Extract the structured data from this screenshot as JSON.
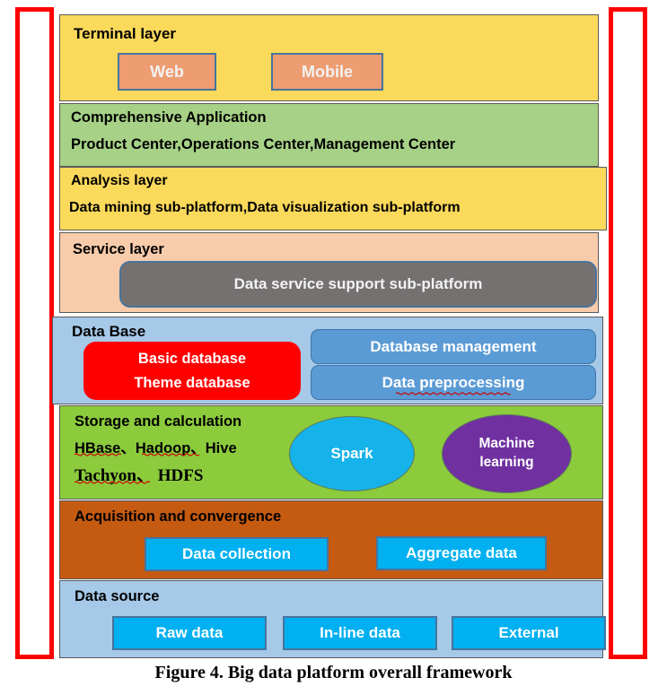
{
  "figure": {
    "caption": "Figure 4. Big data platform overall framework"
  },
  "annotations": {
    "left_bracket_label": "red-highlight-rectangle",
    "right_bracket_label": "red-highlight-rectangle",
    "accent_color": "#FF0000"
  },
  "layers": {
    "terminal": {
      "title": "Terminal layer",
      "color": "#FBD95B",
      "nodes": [
        {
          "label": "Web",
          "color": "#EE9C71"
        },
        {
          "label": "Mobile",
          "color": "#EE9C71"
        }
      ]
    },
    "comprehensive": {
      "title": "Comprehensive Application",
      "subtitle": "Product Center,Operations Center,Management Center",
      "color": "#A6D186"
    },
    "analysis": {
      "title": "Analysis layer",
      "subtitle": "Data mining sub-platform,Data visualization sub-platform",
      "color": "#FBD95B"
    },
    "service": {
      "title": "Service layer",
      "color": "#F8CBAA",
      "nodes": [
        {
          "label": "Data service support sub-platform",
          "color": "#767171"
        }
      ]
    },
    "database": {
      "title": "Data Base",
      "color": "#A6C9E8",
      "nodes": [
        {
          "label_line1": "Basic database",
          "label_line2": "Theme database",
          "color": "#FF0000"
        },
        {
          "label": "Database management",
          "color": "#5B9BD5"
        },
        {
          "label": "Data preprocessing",
          "color": "#5B9BD5"
        }
      ]
    },
    "storage": {
      "title": "Storage and calculation",
      "color": "#8CCB3C",
      "tech_line1": "HBase、Hadoop、Hive",
      "tech_line2": "Tachyon、 HDFS",
      "nodes": [
        {
          "label": "Spark",
          "color": "#16B2EA"
        },
        {
          "label_line1": "Machine",
          "label_line2": "learning",
          "color": "#7030A0"
        }
      ]
    },
    "acquisition": {
      "title": "Acquisition and convergence",
      "color": "#C55A11",
      "nodes": [
        {
          "label": "Data collection",
          "color": "#00B0F0"
        },
        {
          "label": "Aggregate data",
          "color": "#00B0F0"
        }
      ]
    },
    "source": {
      "title": "Data source",
      "color": "#A6C9E8",
      "nodes": [
        {
          "label": "Raw data",
          "color": "#00B0F0"
        },
        {
          "label": "In-line data",
          "color": "#00B0F0"
        },
        {
          "label": "External",
          "color": "#00B0F0"
        }
      ]
    }
  }
}
